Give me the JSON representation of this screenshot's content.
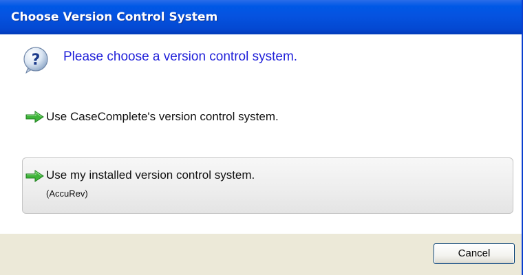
{
  "window": {
    "title": "Choose Version Control System"
  },
  "header": {
    "icon": "question-icon",
    "text": "Please choose a version control system."
  },
  "options": [
    {
      "icon": "green-arrow-icon",
      "label": "Use CaseComplete's version control system.",
      "selected": false
    },
    {
      "icon": "green-arrow-icon",
      "label": "Use my installed version control system.",
      "sublabel": "(AccuRev)",
      "selected": true
    }
  ],
  "buttons": {
    "cancel_label": "Cancel"
  },
  "colors": {
    "titlebar": "#0553e0",
    "header_text": "#1f1fd9",
    "arrow": "#3fb43a",
    "footer": "#ece9d8"
  }
}
